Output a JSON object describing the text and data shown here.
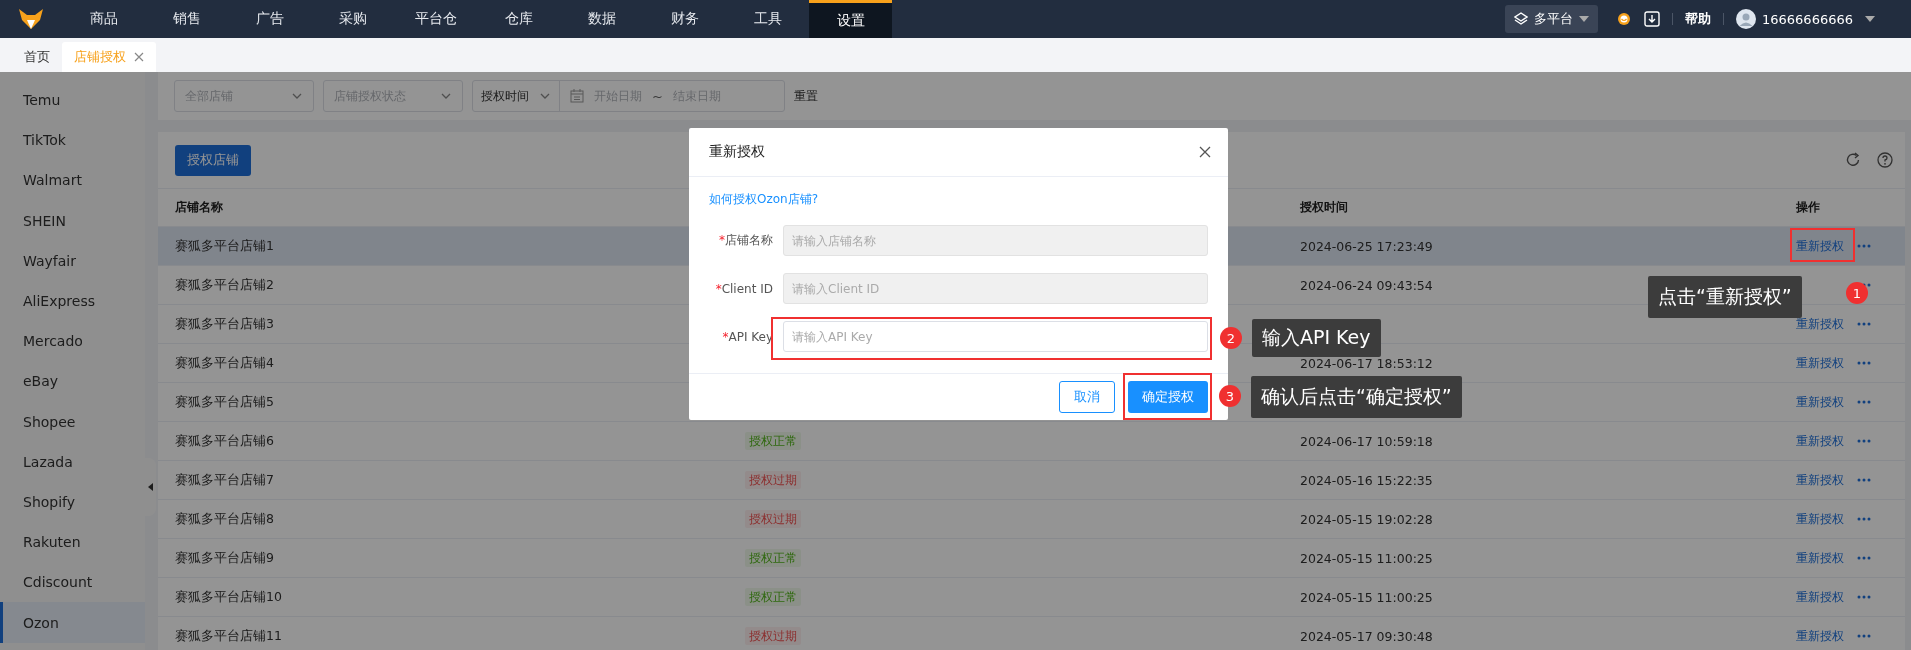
{
  "top_nav": {
    "menu": [
      {
        "label": "商品",
        "selected": false
      },
      {
        "label": "销售",
        "selected": false
      },
      {
        "label": "广告",
        "selected": false
      },
      {
        "label": "采购",
        "selected": false
      },
      {
        "label": "平台仓",
        "selected": false
      },
      {
        "label": "仓库",
        "selected": false
      },
      {
        "label": "数据",
        "selected": false
      },
      {
        "label": "财务",
        "selected": false
      },
      {
        "label": "工具",
        "selected": false
      },
      {
        "label": "设置",
        "selected": true
      }
    ],
    "platform_switch": "多平台",
    "help": "帮助",
    "user": "16666666666"
  },
  "page_tabs": [
    {
      "label": "首页",
      "selected": false,
      "closable": false
    },
    {
      "label": "店铺授权",
      "selected": true,
      "closable": true
    }
  ],
  "sidebar": {
    "items": [
      {
        "label": "Temu",
        "selected": false
      },
      {
        "label": "TikTok",
        "selected": false
      },
      {
        "label": "Walmart",
        "selected": false
      },
      {
        "label": "SHEIN",
        "selected": false
      },
      {
        "label": "Wayfair",
        "selected": false
      },
      {
        "label": "AliExpress",
        "selected": false
      },
      {
        "label": "Mercado",
        "selected": false
      },
      {
        "label": "eBay",
        "selected": false
      },
      {
        "label": "Shopee",
        "selected": false
      },
      {
        "label": "Lazada",
        "selected": false
      },
      {
        "label": "Shopify",
        "selected": false
      },
      {
        "label": "Rakuten",
        "selected": false
      },
      {
        "label": "Cdiscount",
        "selected": false
      },
      {
        "label": "Ozon",
        "selected": true
      }
    ]
  },
  "filters": {
    "store": {
      "placeholder": "全部店铺"
    },
    "status": {
      "placeholder": "店铺授权状态"
    },
    "time_type": "授权时间",
    "start": {
      "placeholder": "开始日期"
    },
    "separator": "~",
    "end": {
      "placeholder": "结束日期"
    },
    "reset": "重置"
  },
  "toolbar": {
    "authorize_button": "授权店铺"
  },
  "table": {
    "columns": [
      "店铺名称",
      "授权时间",
      "操作"
    ],
    "rows": [
      {
        "name": "赛狐多平台店铺1",
        "time": "2024-06-25 17:23:49",
        "action": "重新授权",
        "selected": true
      },
      {
        "name": "赛狐多平台店铺2",
        "time": "2024-06-24 09:43:54",
        "selected": false
      },
      {
        "name": "赛狐多平台店铺3",
        "action": "重新授权",
        "selected": false
      },
      {
        "name": "赛狐多平台店铺4",
        "time": "2024-06-17 18:53:12",
        "action": "重新授权",
        "selected": false
      },
      {
        "name": "赛狐多平台店铺5",
        "action": "重新授权",
        "selected": false
      },
      {
        "name": "赛狐多平台店铺6",
        "status": {
          "text": "授权正常",
          "kind": "ok"
        },
        "time": "2024-06-17 10:59:18",
        "action": "重新授权",
        "selected": false
      },
      {
        "name": "赛狐多平台店铺7",
        "status": {
          "text": "授权过期",
          "kind": "expired"
        },
        "time": "2024-05-16 15:22:35",
        "action": "重新授权",
        "selected": false
      },
      {
        "name": "赛狐多平台店铺8",
        "status": {
          "text": "授权过期",
          "kind": "expired"
        },
        "time": "2024-05-15 19:02:28",
        "action": "重新授权",
        "selected": false
      },
      {
        "name": "赛狐多平台店铺9",
        "status": {
          "text": "授权正常",
          "kind": "ok"
        },
        "time": "2024-05-15 11:00:25",
        "action": "重新授权",
        "selected": false
      },
      {
        "name": "赛狐多平台店铺10",
        "status": {
          "text": "授权正常",
          "kind": "ok"
        },
        "time": "2024-05-15 11:00:25",
        "action": "重新授权",
        "selected": false
      },
      {
        "name": "赛狐多平台店铺11",
        "status": {
          "text": "授权过期",
          "kind": "expired"
        },
        "time": "2024-05-17 09:30:48",
        "action": "重新授权",
        "selected": false
      }
    ]
  },
  "dialog": {
    "title": "重新授权",
    "help_link": "如何授权Ozon店铺?",
    "required_mark": "*",
    "fields": [
      {
        "label": "店铺名称",
        "required": true,
        "placeholder": "请输入店铺名称",
        "disabled": true
      },
      {
        "label": "Client ID",
        "required": true,
        "placeholder": "请输入Client ID",
        "disabled": true
      },
      {
        "label": "API Key",
        "required": true,
        "placeholder": "请输入API Key",
        "disabled": false
      }
    ],
    "buttons": [
      {
        "label": "取消",
        "kind": "default"
      },
      {
        "label": "确定授权",
        "kind": "primary"
      }
    ]
  },
  "annotations": [
    {
      "number": "1",
      "text": "点击“重新授权”"
    },
    {
      "number": "2",
      "text": "输入API Key"
    },
    {
      "number": "3",
      "text": "确认后点击“确定授权”"
    }
  ]
}
